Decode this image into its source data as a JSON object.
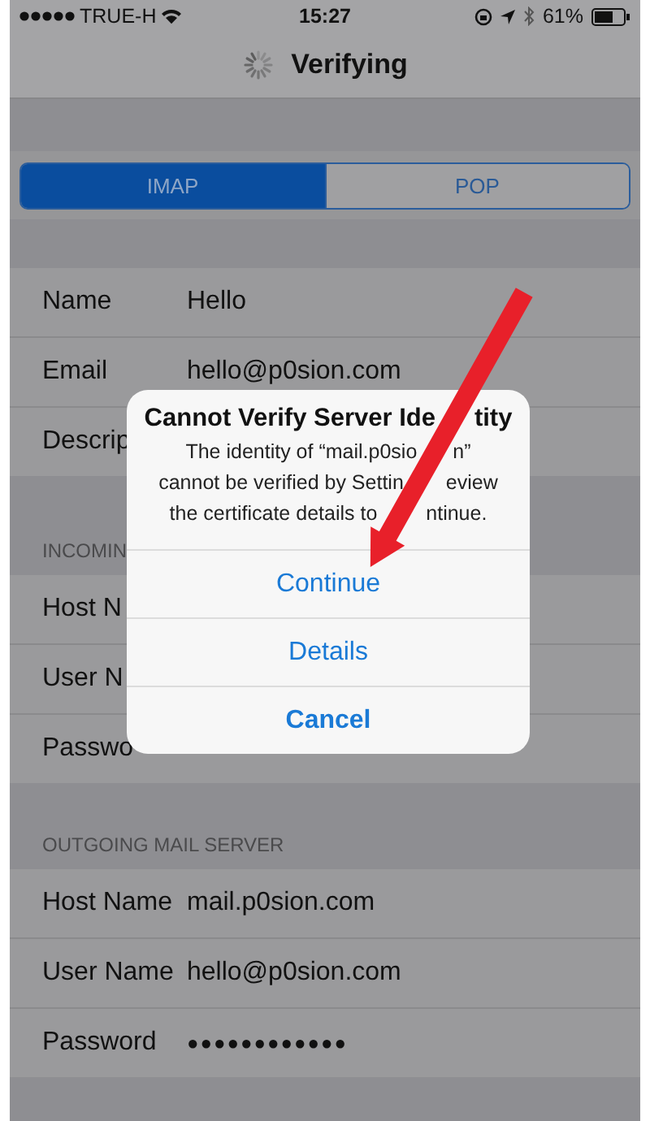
{
  "status_bar": {
    "carrier": "TRUE-H",
    "time": "15:27",
    "battery": "61%"
  },
  "nav": {
    "title": "Verifying"
  },
  "segments": [
    {
      "label": "IMAP",
      "selected": true
    },
    {
      "label": "POP",
      "selected": false
    }
  ],
  "sections": [
    {
      "rows": [
        {
          "label": "Name",
          "value": "Hello"
        },
        {
          "label": "Email",
          "value": "hello@p0sion.com"
        },
        {
          "label": "Descrip"
        }
      ]
    },
    {
      "header": "INCOMIN",
      "rows": [
        {
          "label": "Host N"
        },
        {
          "label": "User N"
        },
        {
          "label": "Passwo"
        }
      ]
    },
    {
      "header": "OUTGOING MAIL SERVER",
      "rows": [
        {
          "label": "Host Name",
          "value": "mail.p0sion.com"
        },
        {
          "label": "User Name",
          "value": "hello@p0sion.com"
        },
        {
          "label": "Password",
          "value": "●●●●●●●●●●●●"
        }
      ]
    }
  ],
  "alert": {
    "title": [
      "Cannot Verify Server Ide",
      "tity"
    ],
    "message_lines": [
      [
        "The identity of “mail.p0sio",
        "n”"
      ],
      [
        "cannot be verified by Settin",
        "eview"
      ],
      [
        "the certificate details to",
        "ntinue."
      ]
    ],
    "buttons": [
      {
        "label": "Continue",
        "kind": "default"
      },
      {
        "label": "Details",
        "kind": "default"
      },
      {
        "label": "Cancel",
        "kind": "cancel"
      }
    ]
  }
}
